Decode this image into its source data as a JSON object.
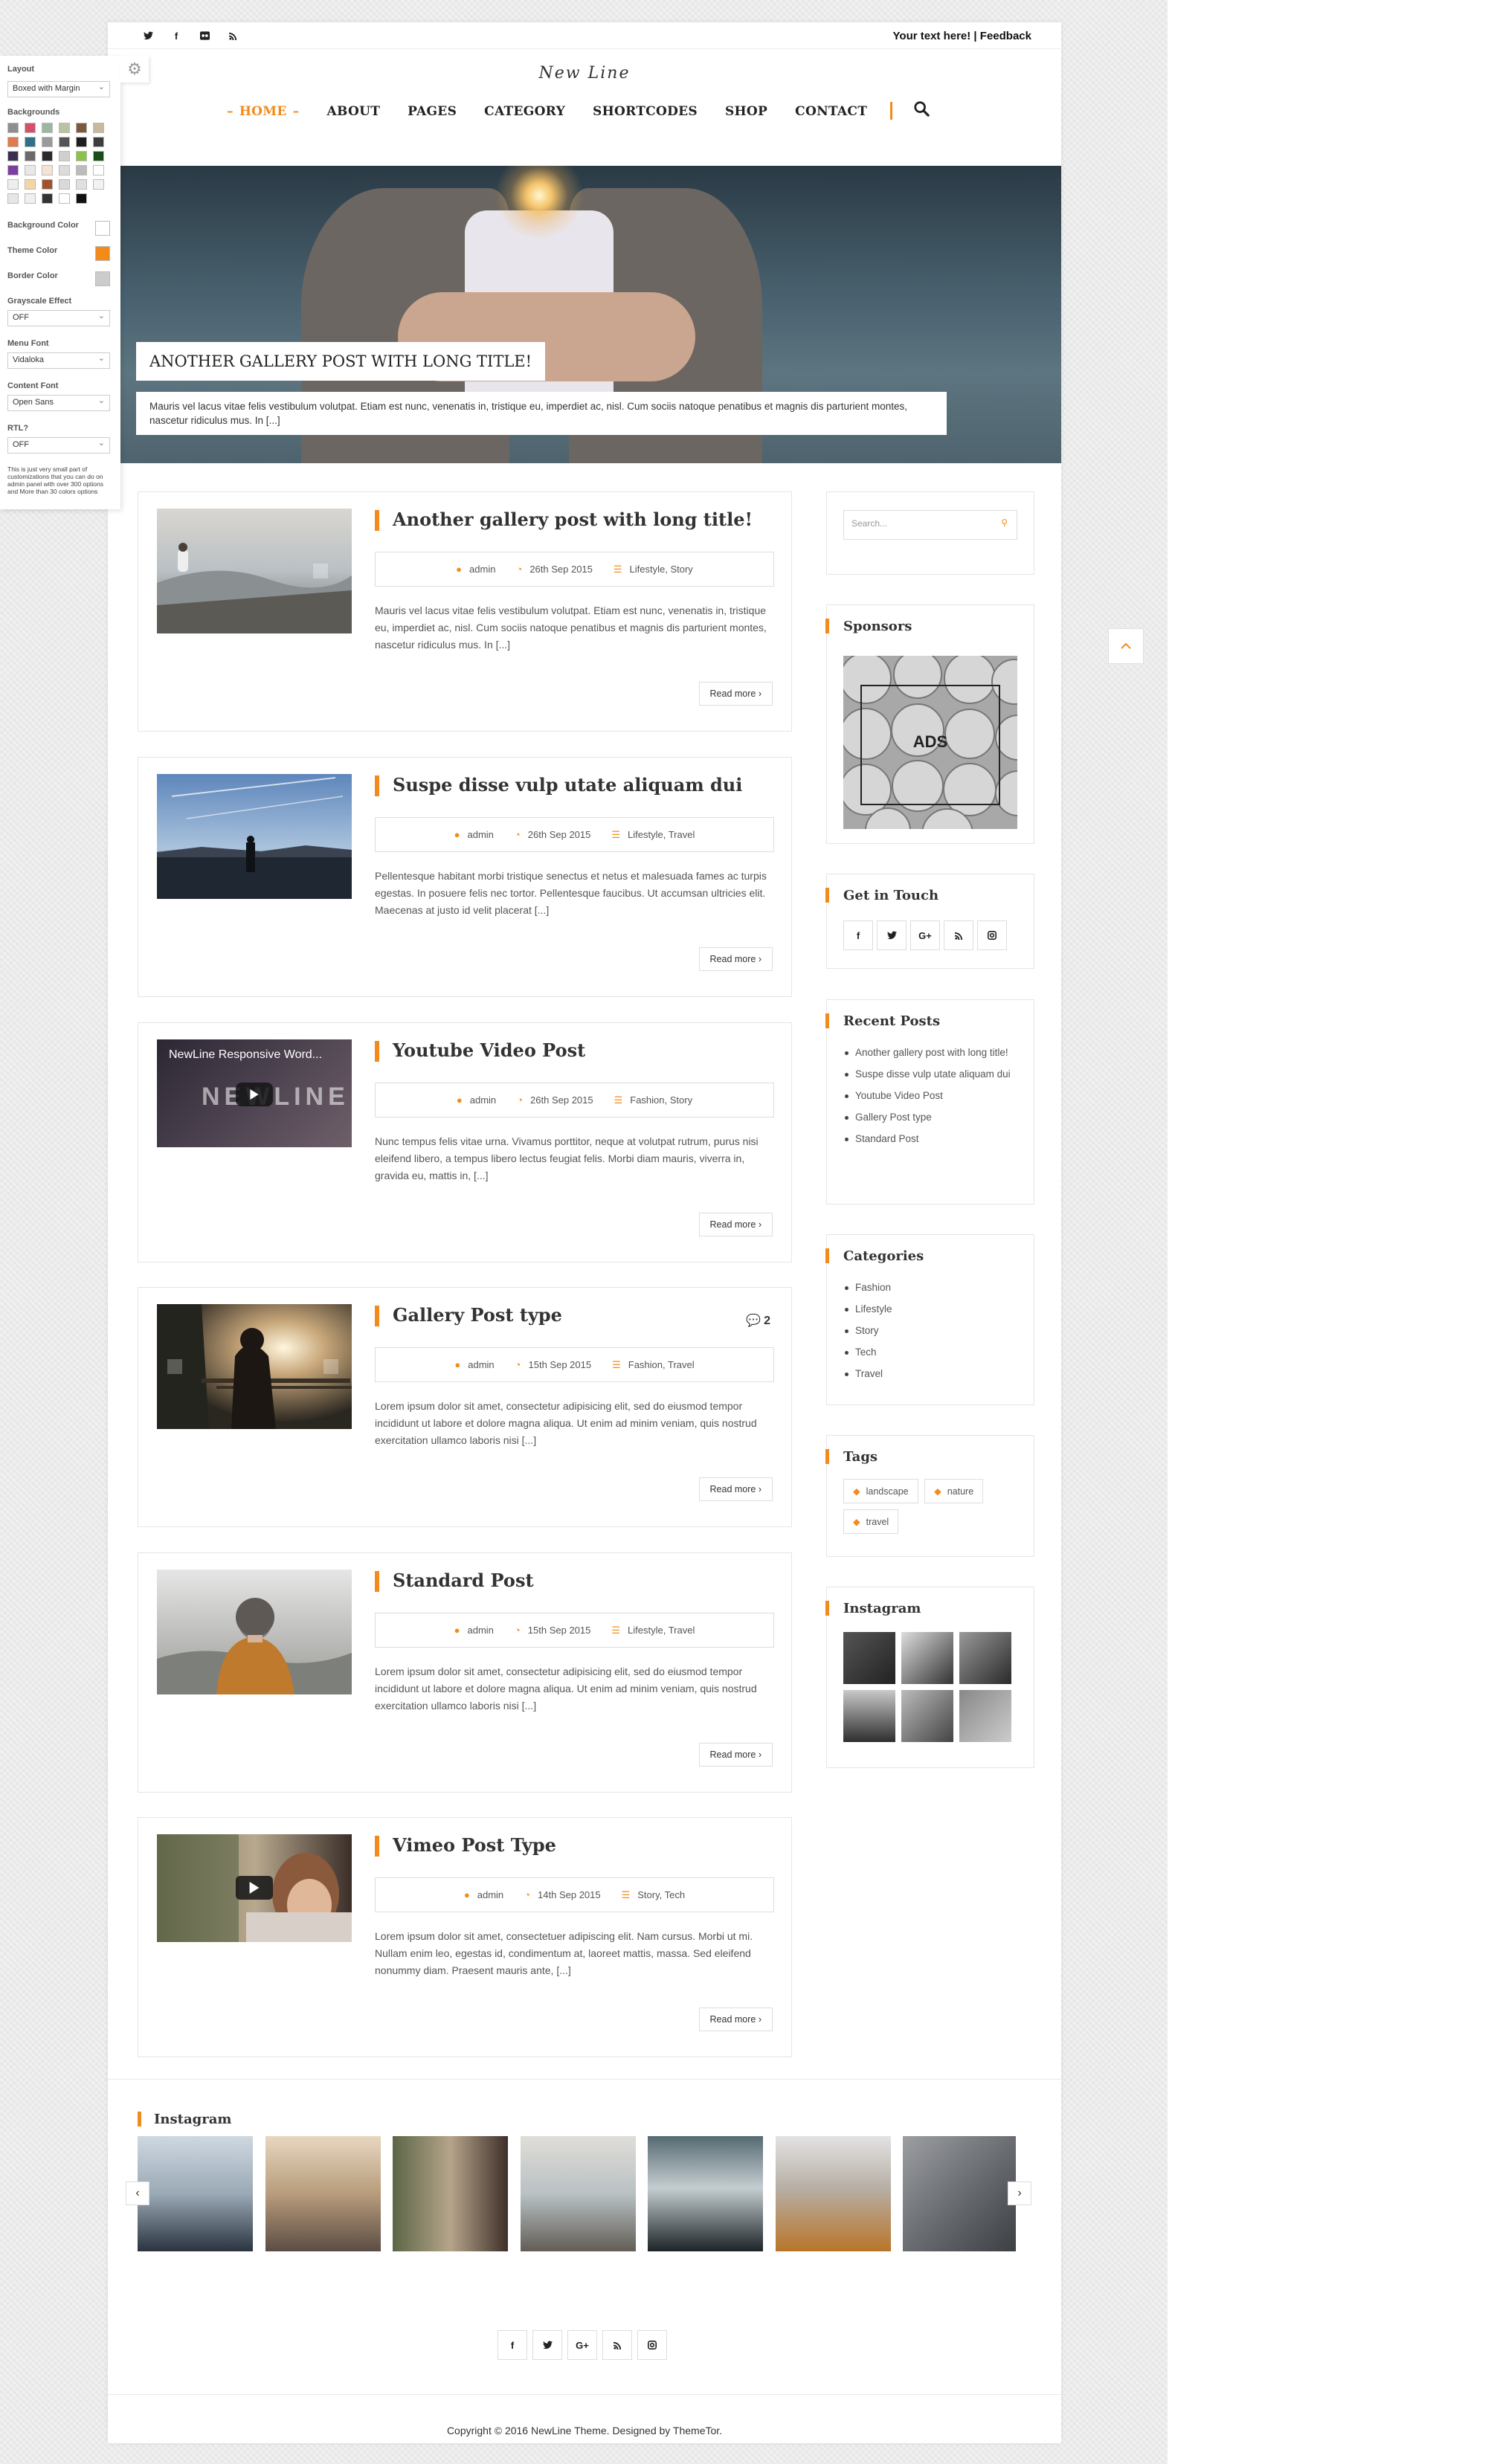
{
  "topbar": {
    "icons": [
      "twitter-icon",
      "facebook-icon",
      "flickr-icon",
      "rss-icon"
    ],
    "text": "Your text here! | Feedback"
  },
  "logo": "New Line",
  "nav": {
    "items": [
      "HOME",
      "ABOUT",
      "PAGES",
      "CATEGORY",
      "SHORTCODES",
      "SHOP",
      "CONTACT"
    ],
    "active": "HOME"
  },
  "hero": {
    "title": "ANOTHER GALLERY POST WITH LONG TITLE!",
    "excerpt": "Mauris vel lacus vitae felis vestibulum volutpat. Etiam est nunc, venenatis in, tristique eu, imperdiet ac, nisl. Cum sociis natoque penatibus et magnis dis parturient montes, nascetur ridiculus mus. In [...]"
  },
  "posts": [
    {
      "title": "Another gallery post with long title!",
      "author": "admin",
      "date": "26th Sep 2015",
      "cats": "Lifestyle, Story",
      "excerpt": "Mauris vel lacus vitae felis vestibulum volutpat. Etiam est nunc, venenatis in, tristique eu, imperdiet ac, nisl. Cum sociis natoque penatibus et magnis dis parturient montes, nascetur ridiculus mus. In [...]",
      "more": "Read more ›"
    },
    {
      "title": "Suspe disse vulp utate aliquam dui",
      "author": "admin",
      "date": "26th Sep 2015",
      "cats": "Lifestyle, Travel",
      "excerpt": "Pellentesque habitant morbi tristique senectus et netus et malesuada fames ac turpis egestas. In posuere felis nec tortor. Pellentesque faucibus. Ut accumsan ultricies elit. Maecenas at justo id velit placerat [...]",
      "more": "Read more ›"
    },
    {
      "title": "Youtube Video Post",
      "author": "admin",
      "date": "26th Sep 2015",
      "cats": "Fashion, Story",
      "excerpt": "Nunc tempus felis vitae urna. Vivamus porttitor, neque at volutpat rutrum, purus nisi eleifend libero, a tempus libero lectus feugiat felis. Morbi diam mauris, viverra in, gravida eu, mattis in, [...]",
      "more": "Read more ›",
      "video_title": "NewLine Responsive Word...",
      "video_brand": "NEWLINE"
    },
    {
      "title": "Gallery Post type",
      "author": "admin",
      "date": "15th Sep 2015",
      "cats": "Fashion, Travel",
      "excerpt": "Lorem ipsum dolor sit amet, consectetur adipisicing elit, sed do eiusmod tempor incididunt ut labore et dolore magna aliqua. Ut enim ad minim veniam, quis nostrud exercitation ullamco laboris nisi [...]",
      "more": "Read more ›",
      "comments": "2"
    },
    {
      "title": "Standard Post",
      "author": "admin",
      "date": "15th Sep 2015",
      "cats": "Lifestyle, Travel",
      "excerpt": "Lorem ipsum dolor sit amet, consectetur adipisicing elit, sed do eiusmod tempor incididunt ut labore et dolore magna aliqua. Ut enim ad minim veniam, quis nostrud exercitation ullamco laboris nisi [...]",
      "more": "Read more ›"
    },
    {
      "title": "Vimeo Post Type",
      "author": "admin",
      "date": "14th Sep 2015",
      "cats": "Story, Tech",
      "excerpt": "Lorem ipsum dolor sit amet, consectetuer adipiscing elit. Nam cursus. Morbi ut mi. Nullam enim leo, egestas id, condimentum at, laoreet mattis, massa. Sed eleifend nonummy diam. Praesent mauris ante, [...]",
      "more": "Read more ›"
    }
  ],
  "sidebar": {
    "search_placeholder": "Search...",
    "sponsors_title": "Sponsors",
    "ads_label": "ADS",
    "touch_title": "Get in Touch",
    "touch_icons": [
      "f",
      "t",
      "G+",
      "rss",
      "ig"
    ],
    "recent_title": "Recent Posts",
    "recent": [
      "Another gallery post with long title!",
      "Suspe disse vulp utate aliquam dui",
      "Youtube Video Post",
      "Gallery Post type",
      "Standard Post"
    ],
    "categories_title": "Categories",
    "categories": [
      "Fashion",
      "Lifestyle",
      "Story",
      "Tech",
      "Travel"
    ],
    "tags_title": "Tags",
    "tags": [
      "landscape",
      "nature",
      "travel"
    ],
    "instagram_title": "Instagram"
  },
  "footer": {
    "instagram_title": "Instagram",
    "social": [
      "f",
      "t",
      "G+",
      "rss",
      "ig"
    ],
    "copyright": "Copyright © 2016 NewLine Theme. Designed by ThemeTor."
  },
  "panel": {
    "layout_label": "Layout",
    "layout_value": "Boxed with Margin",
    "backgrounds_label": "Backgrounds",
    "bg_color_label": "Background Color",
    "theme_color_label": "Theme Color",
    "border_color_label": "Border Color",
    "grayscale_label": "Grayscale Effect",
    "grayscale_value": "OFF",
    "menu_font_label": "Menu Font",
    "menu_font_value": "Vidaloka",
    "content_font_label": "Content Font",
    "content_font_value": "Open Sans",
    "rtl_label": "RTL?",
    "rtl_value": "OFF",
    "note": "This is just very small part of customizations that you can do on admin panel with over 300 options and More than 30 colors options"
  },
  "colors": {
    "accent": "#f28b1a",
    "page_bg": "#ebebeb"
  }
}
